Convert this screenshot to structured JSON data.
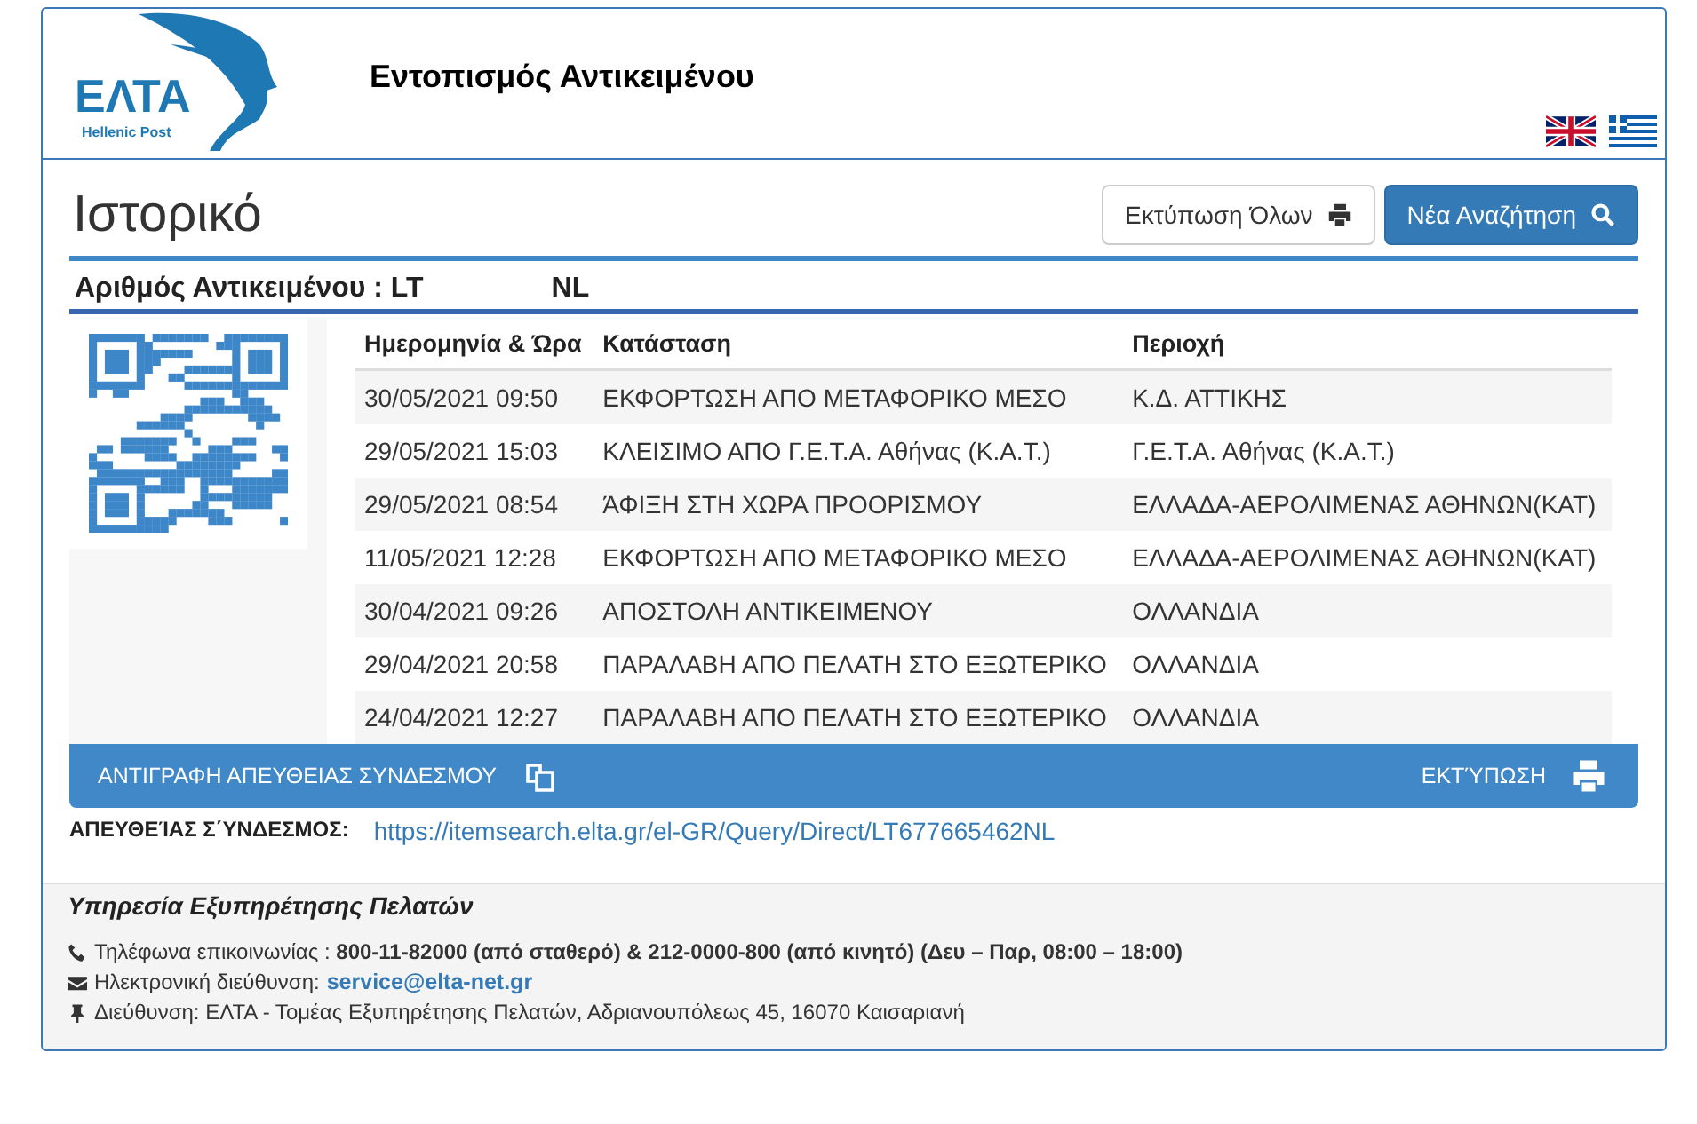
{
  "header": {
    "logo_text": "ΕΛΤΑ",
    "logo_subtitle": "Hellenic Post",
    "title": "Εντοπισμός Αντικειμένου"
  },
  "page_title": "Ιστορικό",
  "buttons": [
    {
      "label": "Εκτύπωση Όλων",
      "kind": "default"
    },
    {
      "label": "Νέα Αναζήτηση",
      "kind": "primary"
    }
  ],
  "item_number": {
    "label": "Αριθμός Αντικειμένου : LT",
    "suffix": "NL"
  },
  "table": {
    "columns": [
      "Ημερομηνία & Ώρα",
      "Κατάσταση",
      "Περιοχή"
    ],
    "rows": [
      [
        "30/05/2021 09:50",
        "ΕΚΦΟΡΤΩΣΗ ΑΠΟ ΜΕΤΑΦΟΡΙΚΟ ΜΕΣΟ",
        "Κ.Δ. ΑΤΤΙΚΗΣ"
      ],
      [
        "29/05/2021 15:03",
        "ΚΛΕΙΣΙΜΟ ΑΠΟ Γ.Ε.Τ.Α. Αθήνας (Κ.Α.Τ.)",
        "Γ.Ε.Τ.Α. Αθήνας (Κ.Α.Τ.)"
      ],
      [
        "29/05/2021 08:54",
        "ΆΦΙΞΗ ΣΤΗ ΧΩΡΑ ΠΡΟΟΡΙΣΜΟΥ",
        "ΕΛΛΑΔΑ-ΑΕΡΟΛΙΜΕΝΑΣ ΑΘΗΝΩΝ(ΚΑΤ)"
      ],
      [
        "11/05/2021 12:28",
        "ΕΚΦΟΡΤΩΣΗ ΑΠΟ ΜΕΤΑΦΟΡΙΚΟ ΜΕΣΟ",
        "ΕΛΛΑΔΑ-ΑΕΡΟΛΙΜΕΝΑΣ ΑΘΗΝΩΝ(ΚΑΤ)"
      ],
      [
        "30/04/2021 09:26",
        "ΑΠΟΣΤΟΛΗ ΑΝΤΙΚΕΙΜΕΝΟΥ",
        "ΟΛΛΑΝΔΙΑ"
      ],
      [
        "29/04/2021 20:58",
        "ΠΑΡΑΛΑΒΗ ΑΠΟ ΠΕΛΑΤΗ ΣΤΟ ΕΞΩΤΕΡΙΚΟ",
        "ΟΛΛΑΝΔΙΑ"
      ],
      [
        "24/04/2021 12:27",
        "ΠΑΡΑΛΑΒΗ ΑΠΟ ΠΕΛΑΤΗ ΣΤΟ ΕΞΩΤΕΡΙΚΟ",
        "ΟΛΛΑΝΔΙΑ"
      ]
    ]
  },
  "action_bar": {
    "copy_label": "ΑΝΤΙΓΡΑΦΗ ΑΠΕΥΘΕΙΑΣ ΣΥΝΔΕΣΜΟΥ",
    "print_label": "ΕΚΤΎΠΩΣΗ"
  },
  "direct_link": {
    "label": "ΑΠΕΥΘΕΊΑΣ Σ΄ΥΝΔΕΣΜΟΣ:",
    "url": "https://itemsearch.elta.gr/el-GR/Query/Direct/LT677665462NL"
  },
  "footer": {
    "title": "Υπηρεσία Εξυπηρέτησης Πελατών",
    "phone": "Τηλέφωνα επικοινωνίας : **800-11-82000 (από σταθερό) & 212-0000-800 (από κινητό) (Δευ – Παρ, 08:00 – 18:00)**",
    "email_label": "Ηλεκτρονική διεύθυνση:",
    "email": "service@elta-net.gr",
    "address": "Διεύθυνση: ΕΛΤΑ - Τομέας Εξυπηρέτησης Πελατών, Αδριανουπόλεως 45, 16070 Καισαριανή"
  }
}
